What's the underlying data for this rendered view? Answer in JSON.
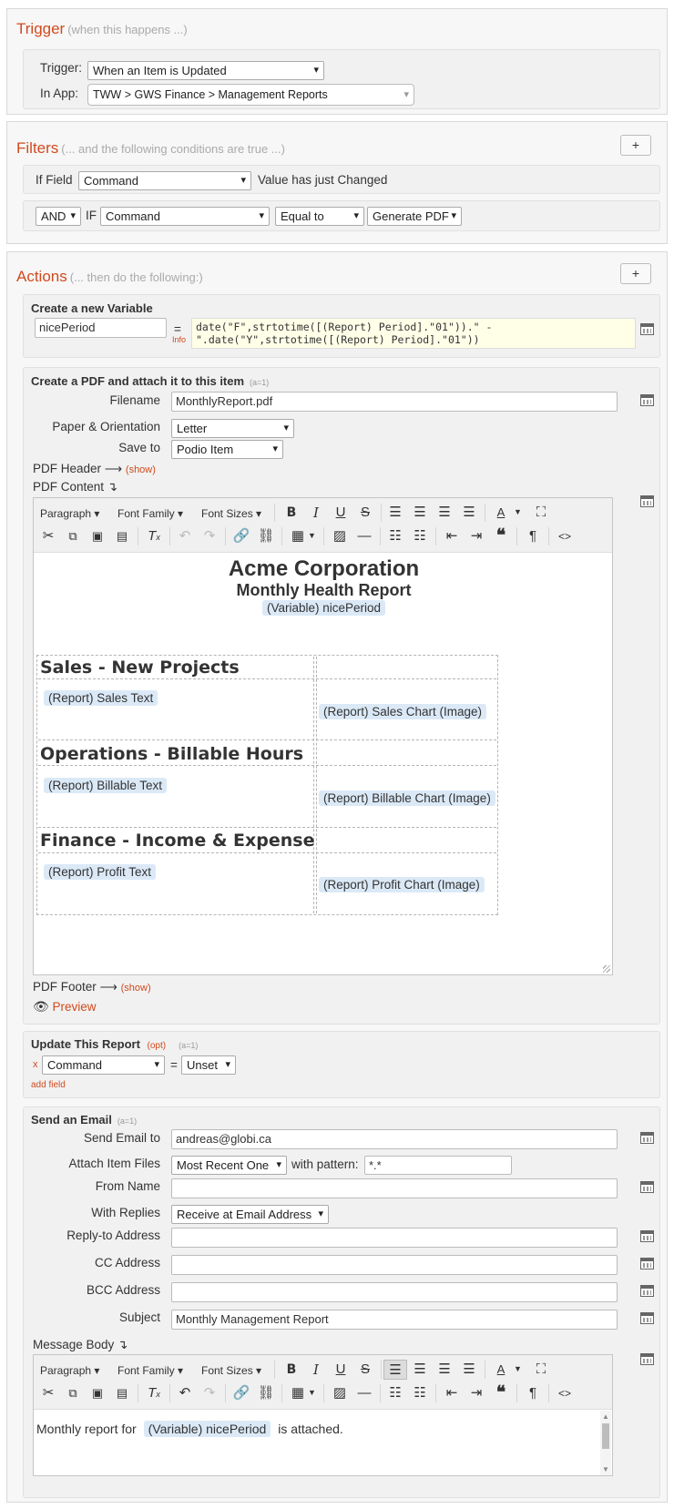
{
  "trigger": {
    "title": "Trigger",
    "note": "(when this happens ...)",
    "trigger_label": "Trigger:",
    "trigger_value": "When an Item is Updated",
    "in_app_label": "In App:",
    "in_app_value": "TWW > GWS Finance > Management Reports"
  },
  "filters": {
    "title": "Filters",
    "note": "(... and the following conditions are true ...)",
    "add_label": "+",
    "row1": {
      "if_label": "If Field",
      "field": "Command",
      "suffix": "Value has just Changed"
    },
    "row2": {
      "conj": "AND",
      "if_label": "IF",
      "field": "Command",
      "op": "Equal to",
      "value": "Generate PDF"
    }
  },
  "actions": {
    "title": "Actions",
    "note": "(... then do the following:)",
    "add_label": "+",
    "variable": {
      "heading": "Create a new Variable",
      "name": "nicePeriod",
      "eq": "=",
      "info": "Info",
      "code_line1": "date(\"F\",strtotime([(Report) Period].\"01\")).\" -",
      "code_line2": "\".date(\"Y\",strtotime([(Report) Period].\"01\"))"
    },
    "pdf": {
      "heading": "Create a PDF and attach it to this item",
      "meta": "(a=1)",
      "filename_label": "Filename",
      "filename": "MonthlyReport.pdf",
      "paper_label": "Paper & Orientation",
      "paper": "Letter",
      "save_label": "Save to",
      "save": "Podio Item",
      "header_label": "PDF Header ⟶",
      "header_show": "(show)",
      "content_label": "PDF Content ↴",
      "footer_label": "PDF Footer ⟶",
      "footer_show": "(show)",
      "preview": "Preview",
      "doc": {
        "title": "Acme Corporation",
        "subtitle": "Monthly Health Report",
        "period": "(Variable) nicePeriod",
        "sections": [
          {
            "heading": "Sales - New Projects",
            "text": "(Report) Sales Text",
            "chart": "(Report) Sales Chart (Image)"
          },
          {
            "heading": "Operations - Billable Hours",
            "text": "(Report) Billable Text",
            "chart": "(Report) Billable Chart (Image)"
          },
          {
            "heading": "Finance - Income & Expense",
            "text": "(Report) Profit Text",
            "chart": "(Report) Profit Chart (Image)"
          }
        ]
      }
    },
    "update": {
      "heading": "Update This Report",
      "opt": "(opt)",
      "meta": "(a=1)",
      "remove": "x",
      "field": "Command",
      "eq": "=",
      "value": "Unset",
      "add_field": "add field"
    },
    "email": {
      "heading": "Send an Email",
      "meta": "(a=1)",
      "to_label": "Send Email to",
      "to": "andreas@globi.ca",
      "attach_label": "Attach Item Files",
      "attach": "Most Recent One",
      "pattern_label": "with pattern:",
      "pattern": "*.*",
      "from_label": "From Name",
      "from": "",
      "replies_label": "With Replies",
      "replies": "Receive at Email Address",
      "replyto_label": "Reply-to Address",
      "replyto": "",
      "cc_label": "CC Address",
      "cc": "",
      "bcc_label": "BCC Address",
      "bcc": "",
      "subject_label": "Subject",
      "subject": "Monthly Management Report",
      "body_label": "Message Body ↴",
      "body_text_before": "Monthly report for",
      "body_var": "(Variable) nicePeriod",
      "body_text_after": "is attached."
    }
  },
  "toolbar": {
    "paragraph": "Paragraph",
    "font_family": "Font Family",
    "font_sizes": "Font Sizes"
  }
}
